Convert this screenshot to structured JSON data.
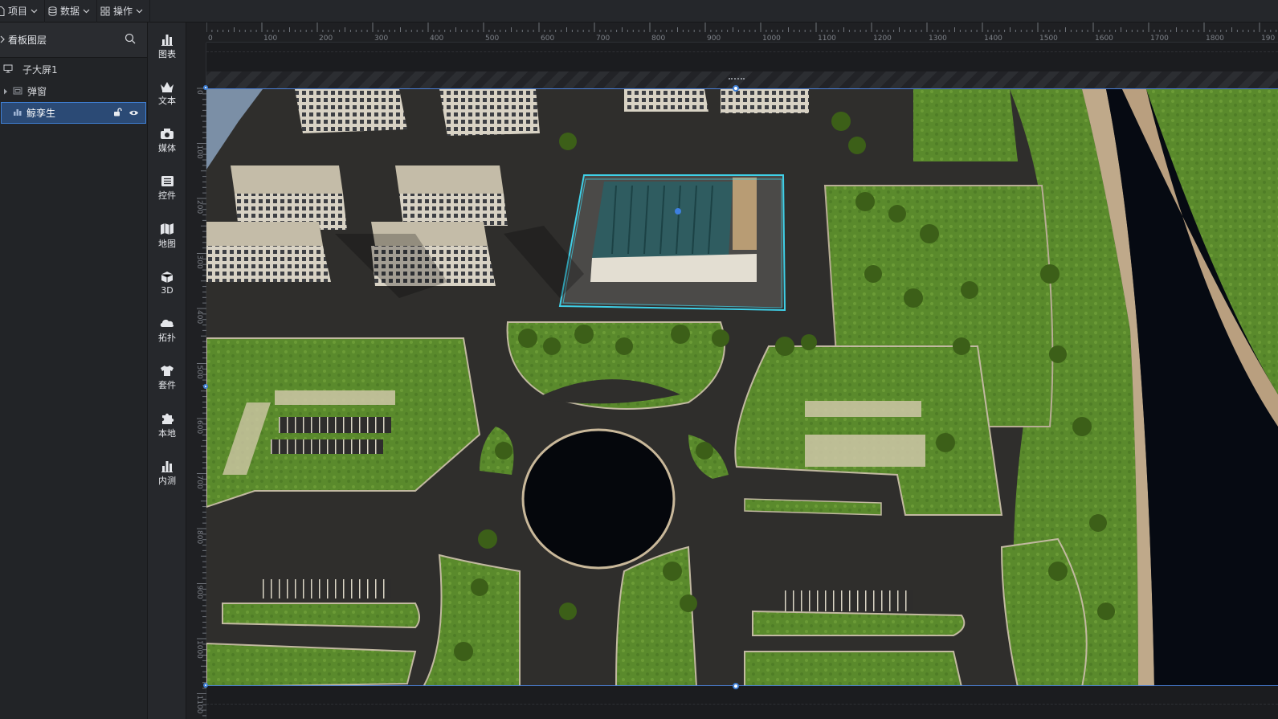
{
  "menubar": {
    "project": "项目",
    "data": "数据",
    "operation": "操作"
  },
  "layers": {
    "title": "看板图层",
    "items": [
      {
        "label": "子大屏1"
      },
      {
        "label": "弹窗"
      },
      {
        "label": "鲸孪生"
      }
    ]
  },
  "toolbar": {
    "items": [
      {
        "label": "图表",
        "icon": "bar-chart-icon"
      },
      {
        "label": "文本",
        "icon": "crown-icon"
      },
      {
        "label": "媒体",
        "icon": "camera-icon"
      },
      {
        "label": "控件",
        "icon": "list-icon"
      },
      {
        "label": "地图",
        "icon": "map-icon"
      },
      {
        "label": "3D",
        "icon": "cube-icon"
      },
      {
        "label": "拓扑",
        "icon": "topology-icon"
      },
      {
        "label": "套件",
        "icon": "shirt-icon"
      },
      {
        "label": "本地",
        "icon": "puzzle-icon"
      },
      {
        "label": "内测",
        "icon": "bar-chart-icon"
      }
    ]
  },
  "ruler": {
    "top": [
      "0",
      "100",
      "200",
      "300",
      "400",
      "500",
      "600",
      "700",
      "800",
      "900",
      "1000",
      "1100",
      "1200",
      "1300",
      "1400",
      "1500",
      "1600",
      "1700",
      "1800",
      "190"
    ],
    "left": [
      "0",
      "100",
      "200",
      "300",
      "400",
      "500",
      "600",
      "700",
      "800",
      "900",
      "1000",
      "1100"
    ]
  },
  "colors": {
    "accent": "#3f7fd4",
    "selection_cyan": "#3fd0e8",
    "grass": "#5e8a2f",
    "road": "#2e2d2c",
    "water": "#070b12"
  }
}
